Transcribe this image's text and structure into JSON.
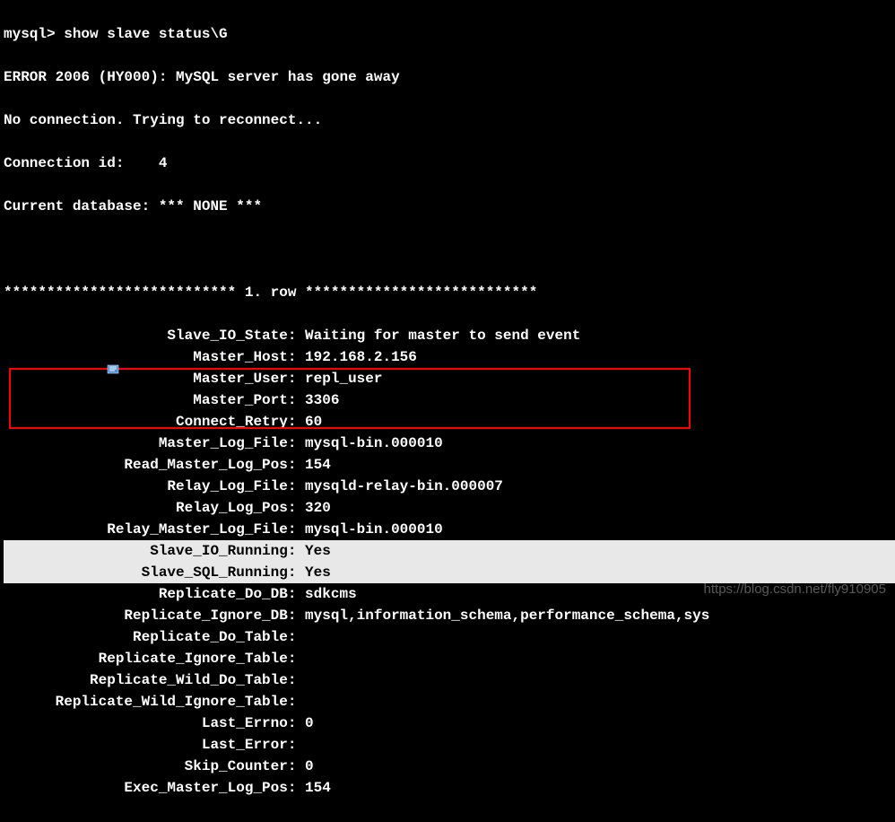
{
  "prompt": "mysql> show slave status\\G",
  "error_line": "ERROR 2006 (HY000): MySQL server has gone away",
  "reconnect_line": "No connection. Trying to reconnect...",
  "connection_id_line": "Connection id:    4",
  "current_db_line": "Current database: *** NONE ***",
  "row_header": "*************************** 1. row ***************************",
  "fields": {
    "Slave_IO_State": "Waiting for master to send event",
    "Master_Host": "192.168.2.156",
    "Master_User": "repl_user",
    "Master_Port": "3306",
    "Connect_Retry": "60",
    "Master_Log_File": "mysql-bin.000010",
    "Read_Master_Log_Pos": "154",
    "Relay_Log_File": "mysqld-relay-bin.000007",
    "Relay_Log_Pos": "320",
    "Relay_Master_Log_File": "mysql-bin.000010",
    "Slave_IO_Running": "Yes",
    "Slave_SQL_Running": "Yes",
    "Replicate_Do_DB": "sdkcms",
    "Replicate_Ignore_DB": "mysql,information_schema,performance_schema,sys",
    "Replicate_Do_Table": "",
    "Replicate_Ignore_Table": "",
    "Replicate_Wild_Do_Table": "",
    "Replicate_Wild_Ignore_Table": "",
    "Last_Errno": "0",
    "Last_Error": "",
    "Skip_Counter": "0",
    "Exec_Master_Log_Pos": "154"
  },
  "highlighted_fields": [
    "Slave_IO_Running",
    "Slave_SQL_Running"
  ],
  "watermark": "https://blog.csdn.net/fly910905",
  "label_width": 33
}
